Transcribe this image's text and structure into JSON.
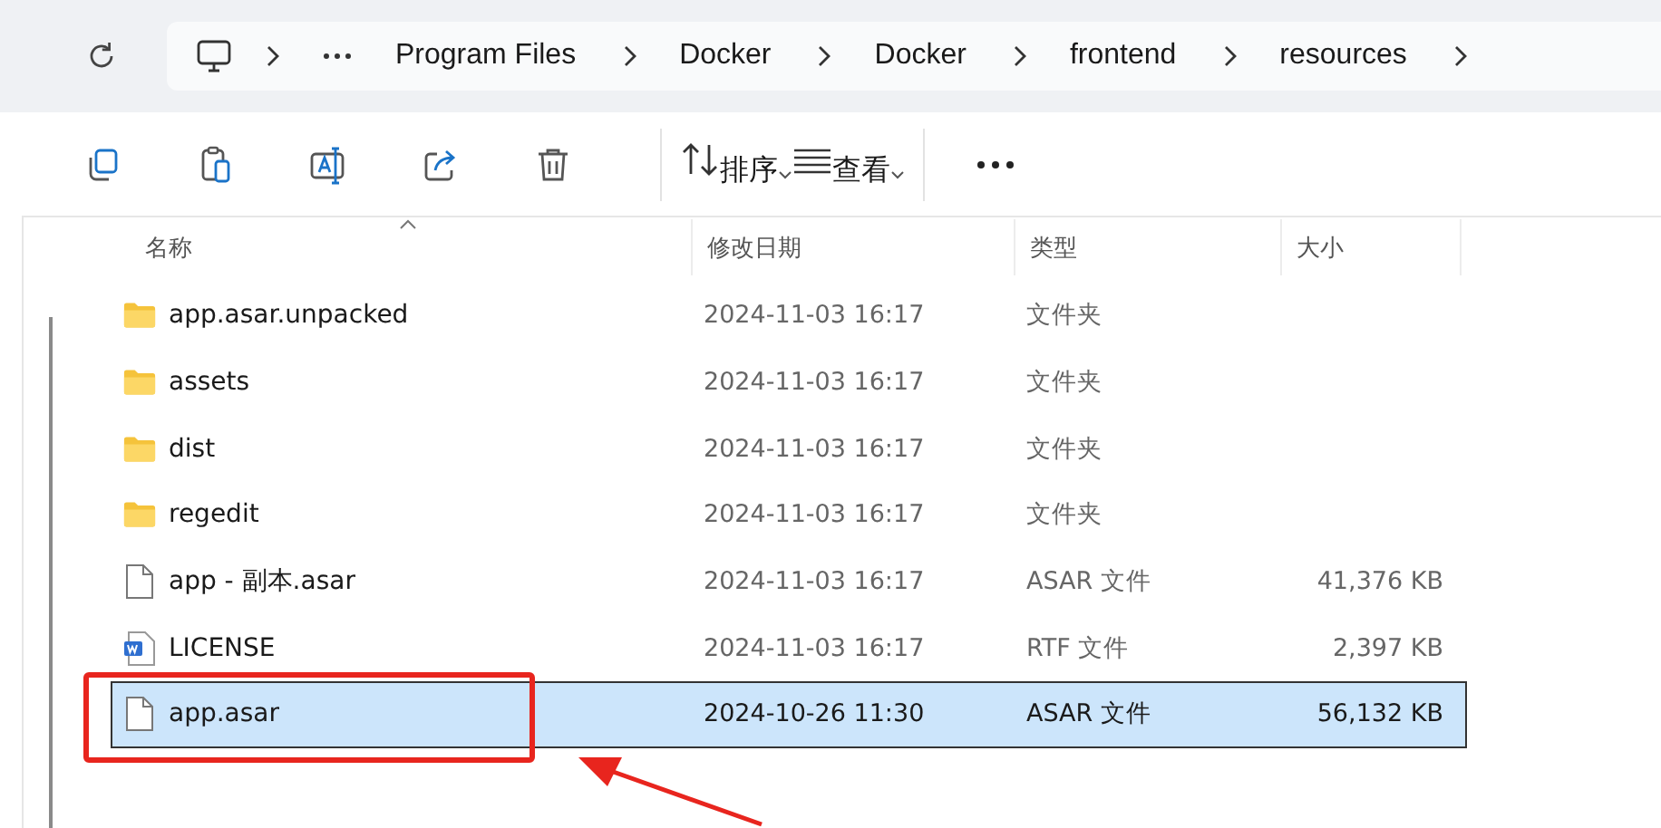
{
  "address_bar": {
    "breadcrumbs": [
      "Program Files",
      "Docker",
      "Docker",
      "frontend",
      "resources"
    ]
  },
  "toolbar": {
    "sort": "排序",
    "view": "查看"
  },
  "file_list": {
    "columns": [
      {
        "label": "名称",
        "sorted": true
      },
      {
        "label": "修改日期",
        "sorted": false
      },
      {
        "label": "类型",
        "sorted": false
      },
      {
        "label": "大小",
        "sorted": false
      }
    ],
    "rows": [
      {
        "kind": "folder",
        "name": "app.asar.unpacked",
        "modified": "2024-11-03 16:17",
        "type": "文件夹",
        "selected": false
      },
      {
        "kind": "folder",
        "name": "assets",
        "modified": "2024-11-03 16:17",
        "type": "文件夹",
        "selected": false
      },
      {
        "kind": "folder",
        "name": "dist",
        "modified": "2024-11-03 16:17",
        "type": "文件夹",
        "selected": false
      },
      {
        "kind": "folder",
        "name": "regedit",
        "modified": "2024-11-03 16:17",
        "type": "文件夹",
        "selected": false
      },
      {
        "kind": "file",
        "name": "app - 副本.asar",
        "modified": "2024-11-03 16:17",
        "type": "ASAR 文件",
        "size": "41,376 KB",
        "selected": false
      },
      {
        "kind": "document",
        "name": "LICENSE",
        "modified": "2024-11-03 16:17",
        "type": "RTF 文件",
        "size": "2,397 KB",
        "selected": false
      },
      {
        "kind": "file",
        "name": "app.asar",
        "modified": "2024-10-26 11:30",
        "type": "ASAR 文件",
        "size": "56,132 KB",
        "selected": true
      }
    ]
  }
}
